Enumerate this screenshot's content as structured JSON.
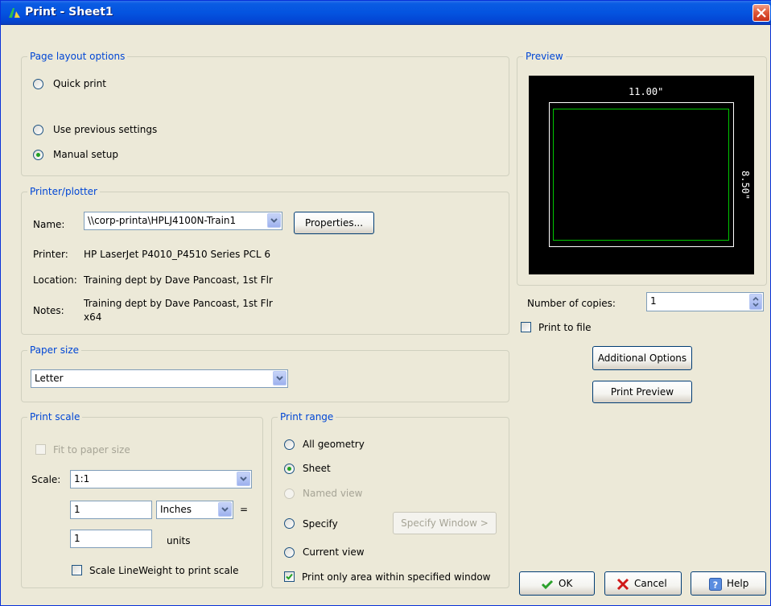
{
  "window": {
    "title": "Print - Sheet1"
  },
  "page_layout": {
    "legend": "Page layout options",
    "options": [
      {
        "label": "Quick print",
        "checked": false
      },
      {
        "label": "Use previous settings",
        "checked": false
      },
      {
        "label": "Manual setup",
        "checked": true
      }
    ]
  },
  "printer": {
    "legend": "Printer/plotter",
    "name_label": "Name:",
    "name_value": "\\\\corp-printa\\HPLJ4100N-Train1",
    "properties_label": "Properties...",
    "printer_label": "Printer:",
    "printer_value": "HP LaserJet P4010_P4510 Series PCL 6",
    "location_label": "Location:",
    "location_value": "Training dept by Dave Pancoast, 1st Flr",
    "notes_label": "Notes:",
    "notes_line1": "Training dept by Dave Pancoast, 1st Flr",
    "notes_line2": "x64"
  },
  "paper_size": {
    "legend": "Paper size",
    "value": "Letter"
  },
  "print_scale": {
    "legend": "Print scale",
    "fit_label": "Fit to paper size",
    "fit_checked": false,
    "scale_label": "Scale:",
    "scale_value": "1:1",
    "num1": "1",
    "unit1": "Inches",
    "equals": "=",
    "num2": "1",
    "unit2": "units",
    "lineweight_label": "Scale LineWeight to print scale",
    "lineweight_checked": false
  },
  "print_range": {
    "legend": "Print range",
    "all_geometry": "All geometry",
    "sheet": "Sheet",
    "named_view": "Named view",
    "specify": "Specify",
    "specify_window": "Specify Window >",
    "current_view": "Current view",
    "only_area": "Print only area within specified window",
    "selected": "Sheet",
    "only_area_checked": true
  },
  "preview": {
    "legend": "Preview",
    "width_label": "11.00\"",
    "height_label": "8.50\""
  },
  "copies": {
    "label": "Number of copies:",
    "value": "1"
  },
  "print_to_file": {
    "label": "Print to file",
    "checked": false
  },
  "buttons": {
    "additional": "Additional Options",
    "preview": "Print Preview",
    "ok": "OK",
    "cancel": "Cancel",
    "help": "Help"
  },
  "colors": {
    "title_bar": "#0454e0",
    "legend_text": "#0046d5",
    "dialog_bg": "#ece9d8",
    "preview_border_outer": "#ffffff",
    "preview_border_inner": "#00c800"
  }
}
